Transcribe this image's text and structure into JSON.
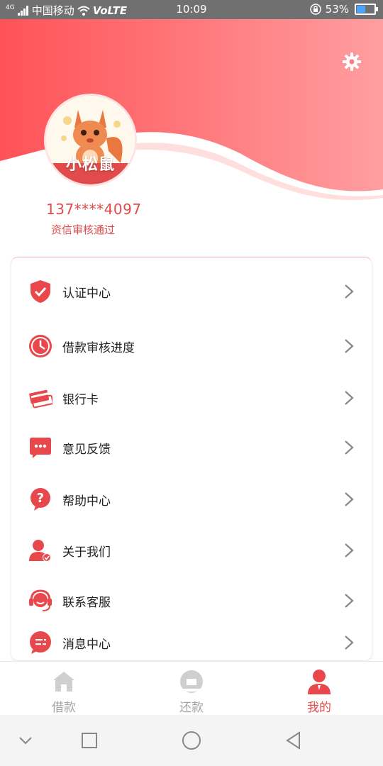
{
  "status_bar": {
    "network": "4G",
    "carrier": "中国移动",
    "volte": "VoLTE",
    "time": "10:09",
    "battery": "53%",
    "battery_level": 0.53
  },
  "profile": {
    "avatar_text": "小松鼠",
    "phone": "137****4097",
    "status": "资信审核通过"
  },
  "menu": {
    "items": [
      {
        "label": "认证中心",
        "icon": "shield-check-icon"
      },
      {
        "label": "借款审核进度",
        "icon": "clock-icon"
      },
      {
        "label": "银行卡",
        "icon": "bank-card-icon"
      },
      {
        "label": "意见反馈",
        "icon": "chat-bubble-icon"
      },
      {
        "label": "帮助中心",
        "icon": "question-bubble-icon"
      },
      {
        "label": "关于我们",
        "icon": "user-check-icon"
      },
      {
        "label": "联系客服",
        "icon": "headset-icon"
      },
      {
        "label": "消息中心",
        "icon": "message-icon"
      }
    ]
  },
  "tabs": [
    {
      "label": "借款",
      "icon": "house-icon",
      "active": false
    },
    {
      "label": "还款",
      "icon": "repay-icon",
      "active": false
    },
    {
      "label": "我的",
      "icon": "person-icon",
      "active": true
    }
  ],
  "colors": {
    "accent": "#e24b4b",
    "header_start": "#ff5a5f",
    "header_end": "#ff9ea0",
    "inactive": "#a5a5a5"
  }
}
